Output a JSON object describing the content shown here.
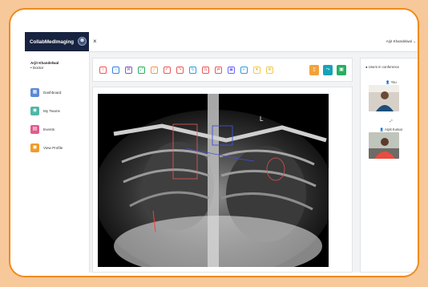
{
  "app": {
    "brand": "CollabMedImaging",
    "menu_toggle": "⊗",
    "close_icon": "×",
    "account_name": "Arjit Khandelwal",
    "account_chevron": "⌄"
  },
  "user": {
    "name": "Arjit Khandelwal",
    "role": "• Doctor"
  },
  "nav": [
    {
      "label": "Dashboard",
      "icon": "▦",
      "color": "#5a89d8"
    },
    {
      "label": "My Teams",
      "icon": "◉",
      "color": "#4fb7a8"
    },
    {
      "label": "Events",
      "icon": "▤",
      "color": "#e35a8c"
    },
    {
      "label": "View Profile",
      "icon": "◼",
      "color": "#f39a2b"
    }
  ],
  "toolbar": {
    "tools": [
      {
        "name": "square-tool-icon",
        "glyph": "□",
        "color": "#ef5350"
      },
      {
        "name": "circle-tool-icon",
        "glyph": "○",
        "color": "#2f80ed"
      },
      {
        "name": "polygon-tool-icon",
        "glyph": "⌘",
        "color": "#7e57c2"
      },
      {
        "name": "arrow-tool-icon",
        "glyph": "⤢",
        "color": "#27ae60"
      },
      {
        "name": "pen-tool-icon",
        "glyph": "╱",
        "color": "#f2994a"
      },
      {
        "name": "undo-icon",
        "glyph": "↶",
        "color": "#eb5757"
      },
      {
        "name": "redo-icon",
        "glyph": "↷",
        "color": "#eb5757"
      },
      {
        "name": "rotate-left-icon",
        "glyph": "↻",
        "color": "#2d9cdb"
      },
      {
        "name": "flip-vertical-icon",
        "glyph": "⇅",
        "color": "#eb5757"
      },
      {
        "name": "flip-horizontal-icon",
        "glyph": "⇄",
        "color": "#eb5757"
      },
      {
        "name": "invert-icon",
        "glyph": "▣",
        "color": "#6c63ff"
      },
      {
        "name": "contrast-icon",
        "glyph": "◐",
        "color": "#2d9cdb"
      },
      {
        "name": "brightness-up-icon",
        "glyph": "✹",
        "color": "#f2c94c"
      },
      {
        "name": "brightness-down-icon",
        "glyph": "✺",
        "color": "#f2c94c"
      }
    ],
    "actions": [
      {
        "name": "save-button",
        "glyph": "▯",
        "color": "#f2a23a"
      },
      {
        "name": "share-button",
        "glyph": "⤳",
        "color": "#16a3b7"
      },
      {
        "name": "download-button",
        "glyph": "▣",
        "color": "#27ae60"
      }
    ]
  },
  "image": {
    "marker": "L"
  },
  "conference": {
    "title": "Users in conference",
    "participants": [
      {
        "name": "You"
      },
      {
        "name": "Arpit Kumar"
      }
    ],
    "expand_icon": "⤢"
  }
}
